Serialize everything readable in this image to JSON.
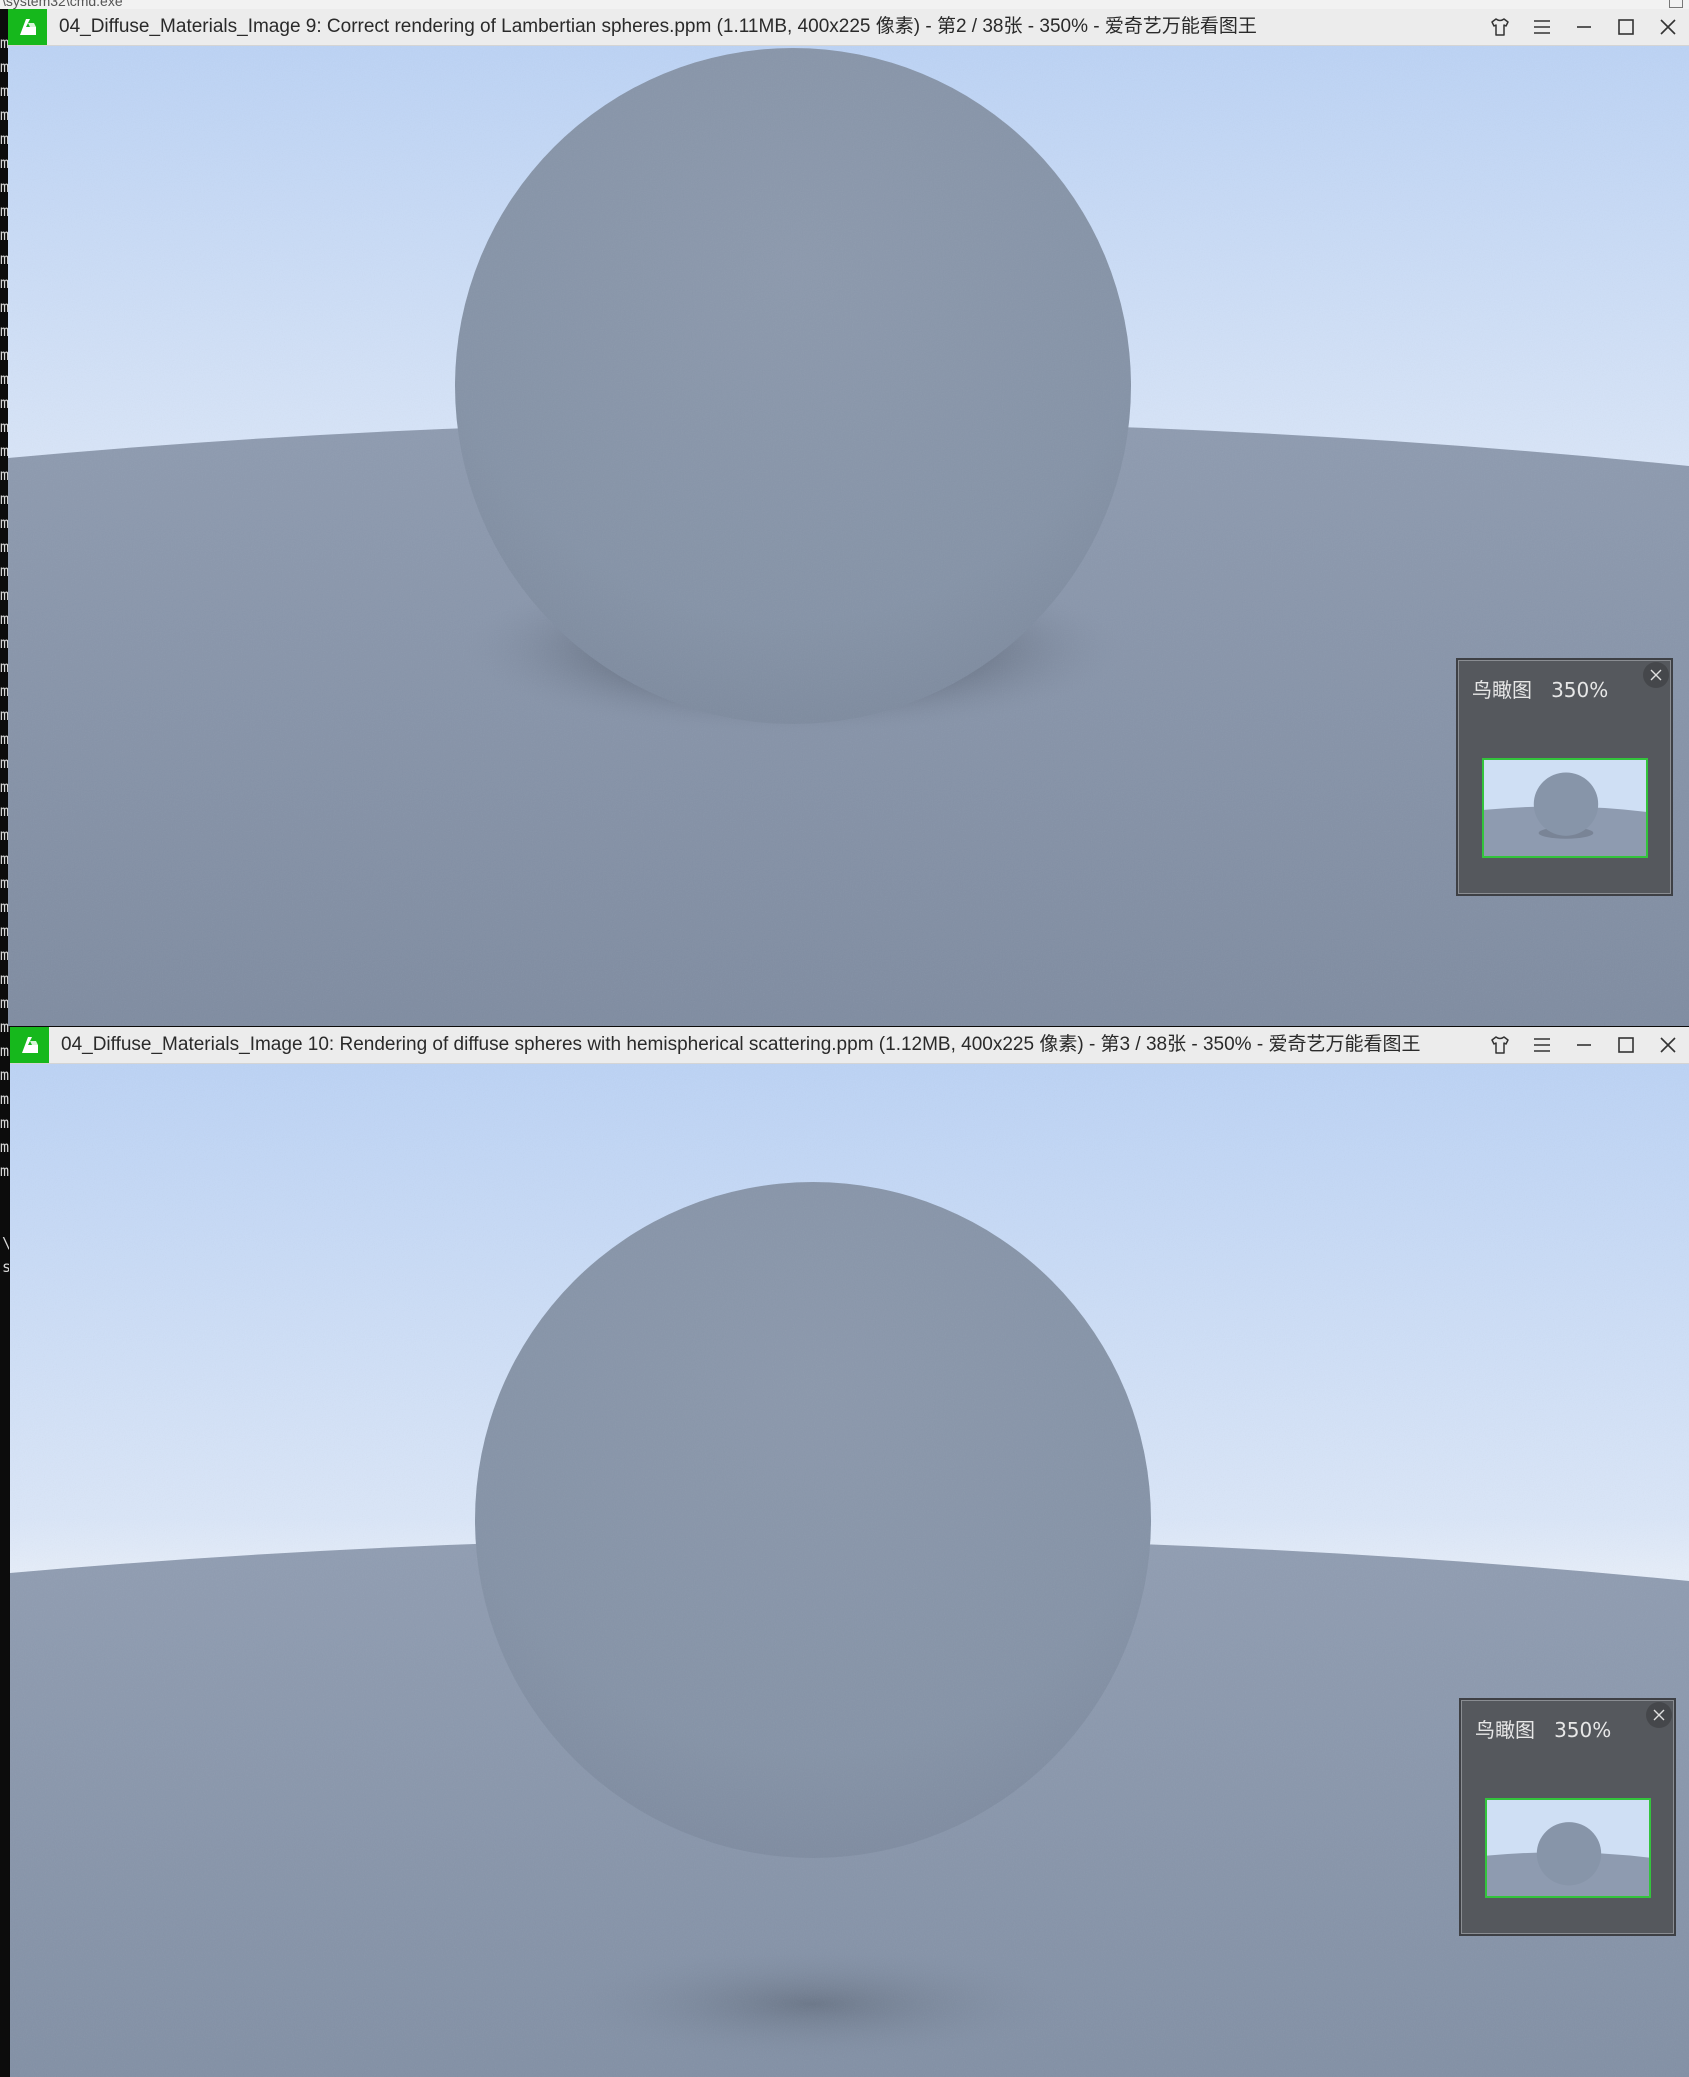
{
  "console": {
    "title_fragment": "\\system32\\cmd.exe",
    "left_chars": [
      "m",
      "m",
      "m",
      "m",
      "m",
      "m",
      "m",
      "m",
      "m",
      "m",
      "m",
      "m",
      "m",
      "m",
      "m",
      "m",
      "m",
      "m",
      "m",
      "m",
      "m",
      "m",
      "m",
      "m",
      "m",
      "m",
      "m",
      "m",
      "m",
      "m",
      "m",
      "m",
      "m",
      "m",
      "m",
      "m",
      "m",
      "m",
      "m",
      "m",
      "m",
      "m",
      "m",
      "m",
      "m",
      "m",
      "m",
      "m"
    ],
    "extra_lines": [
      "\\",
      "s"
    ]
  },
  "windows": [
    {
      "title": "04_Diffuse_Materials_Image 9:  Correct rendering of Lambertian spheres.ppm (1.11MB, 400x225 像素) - 第2 / 38张 - 350% - 爱奇艺万能看图王",
      "birdseye": {
        "label": "鸟瞰图",
        "zoom": "350%"
      }
    },
    {
      "title": "04_Diffuse_Materials_Image 10:  Rendering of diffuse spheres with hemispherical scattering.ppm (1.12MB, 400x225 像素) - 第3 / 38张 - 350% - 爱奇艺万能看图王",
      "birdseye": {
        "label": "鸟瞰图",
        "zoom": "350%"
      }
    }
  ],
  "icons": {
    "logo": "app-logo-icon",
    "skin": "shirt-skin-icon",
    "menu": "hamburger-menu-icon",
    "minimize": "minimize-icon",
    "maximize": "maximize-icon",
    "close": "close-icon"
  },
  "colors": {
    "logo_green": "#16b81c",
    "thumb_border": "#33c43c",
    "sky_top": "#bfd5f6",
    "sky_bottom": "#e3ecf8",
    "ground": "#8593a8",
    "sphere": "#8896a9"
  }
}
